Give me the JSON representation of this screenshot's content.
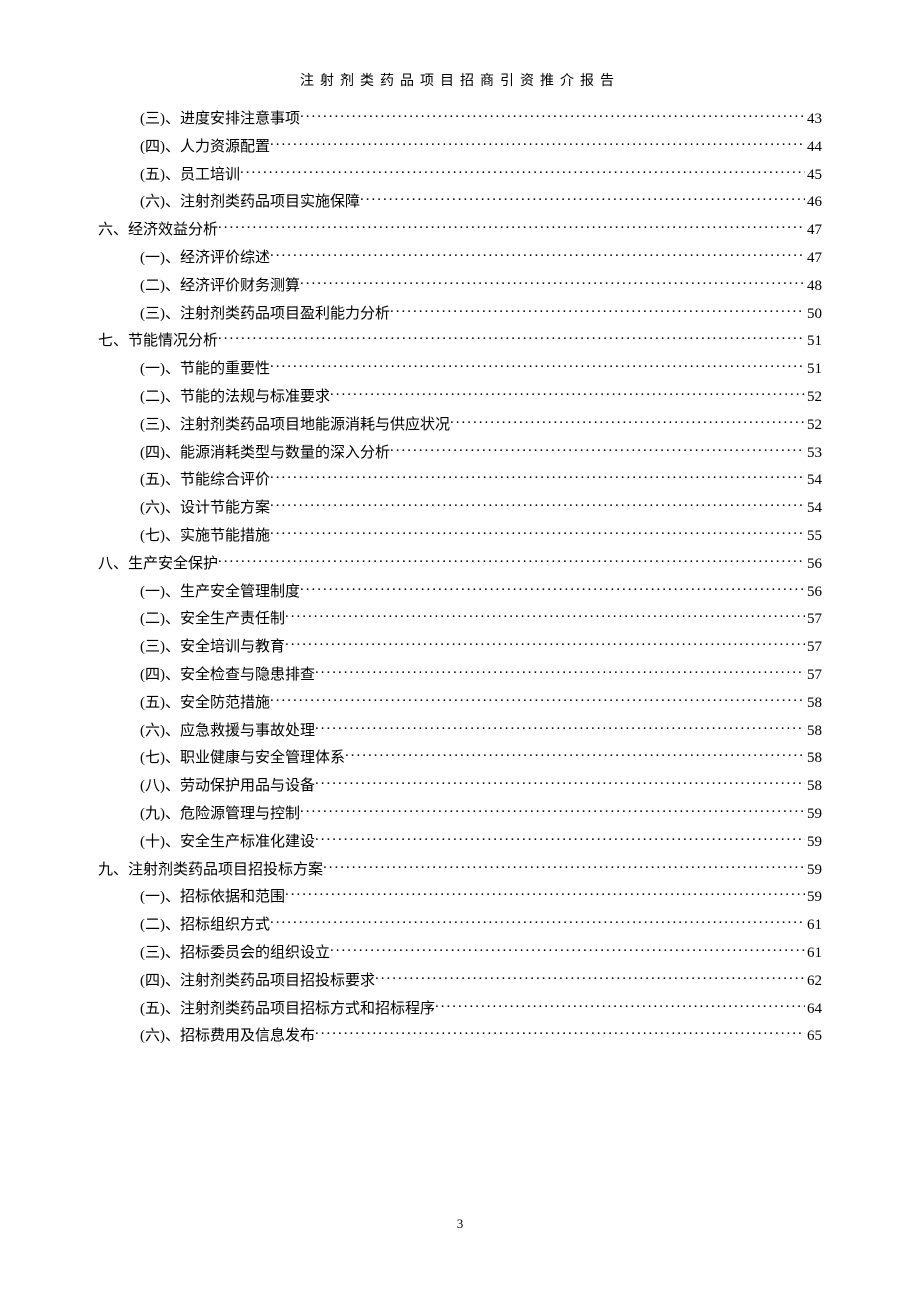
{
  "header": "注射剂类药品项目招商引资推介报告",
  "footer_page": "3",
  "toc": [
    {
      "level": 2,
      "label": "(三)、进度安排注意事项",
      "page": "43"
    },
    {
      "level": 2,
      "label": "(四)、人力资源配置",
      "page": "44"
    },
    {
      "level": 2,
      "label": "(五)、员工培训",
      "page": "45"
    },
    {
      "level": 2,
      "label": "(六)、注射剂类药品项目实施保障",
      "page": "46"
    },
    {
      "level": 1,
      "label": "六、经济效益分析",
      "page": "47"
    },
    {
      "level": 2,
      "label": "(一)、经济评价综述",
      "page": "47"
    },
    {
      "level": 2,
      "label": "(二)、经济评价财务测算",
      "page": "48"
    },
    {
      "level": 2,
      "label": "(三)、注射剂类药品项目盈利能力分析",
      "page": "50"
    },
    {
      "level": 1,
      "label": "七、节能情况分析",
      "page": "51"
    },
    {
      "level": 2,
      "label": "(一)、节能的重要性",
      "page": "51"
    },
    {
      "level": 2,
      "label": "(二)、节能的法规与标准要求",
      "page": "52"
    },
    {
      "level": 2,
      "label": "(三)、注射剂类药品项目地能源消耗与供应状况",
      "page": "52"
    },
    {
      "level": 2,
      "label": "(四)、能源消耗类型与数量的深入分析",
      "page": "53"
    },
    {
      "level": 2,
      "label": "(五)、节能综合评价",
      "page": "54"
    },
    {
      "level": 2,
      "label": "(六)、设计节能方案",
      "page": "54"
    },
    {
      "level": 2,
      "label": "(七)、实施节能措施",
      "page": "55"
    },
    {
      "level": 1,
      "label": "八、生产安全保护",
      "page": "56"
    },
    {
      "level": 2,
      "label": "(一)、生产安全管理制度",
      "page": "56"
    },
    {
      "level": 2,
      "label": "(二)、安全生产责任制",
      "page": "57"
    },
    {
      "level": 2,
      "label": "(三)、安全培训与教育",
      "page": "57"
    },
    {
      "level": 2,
      "label": "(四)、安全检查与隐患排查",
      "page": "57"
    },
    {
      "level": 2,
      "label": "(五)、安全防范措施",
      "page": "58"
    },
    {
      "level": 2,
      "label": "(六)、应急救援与事故处理",
      "page": "58"
    },
    {
      "level": 2,
      "label": "(七)、职业健康与安全管理体系",
      "page": "58"
    },
    {
      "level": 2,
      "label": "(八)、劳动保护用品与设备",
      "page": "58"
    },
    {
      "level": 2,
      "label": "(九)、危险源管理与控制",
      "page": "59"
    },
    {
      "level": 2,
      "label": "(十)、安全生产标准化建设",
      "page": "59"
    },
    {
      "level": 1,
      "label": "九、注射剂类药品项目招投标方案",
      "page": "59"
    },
    {
      "level": 2,
      "label": "(一)、招标依据和范围",
      "page": "59"
    },
    {
      "level": 2,
      "label": "(二)、招标组织方式",
      "page": "61"
    },
    {
      "level": 2,
      "label": "(三)、招标委员会的组织设立",
      "page": "61"
    },
    {
      "level": 2,
      "label": "(四)、注射剂类药品项目招投标要求",
      "page": "62"
    },
    {
      "level": 2,
      "label": "(五)、注射剂类药品项目招标方式和招标程序",
      "page": "64"
    },
    {
      "level": 2,
      "label": "(六)、招标费用及信息发布",
      "page": "65"
    }
  ]
}
